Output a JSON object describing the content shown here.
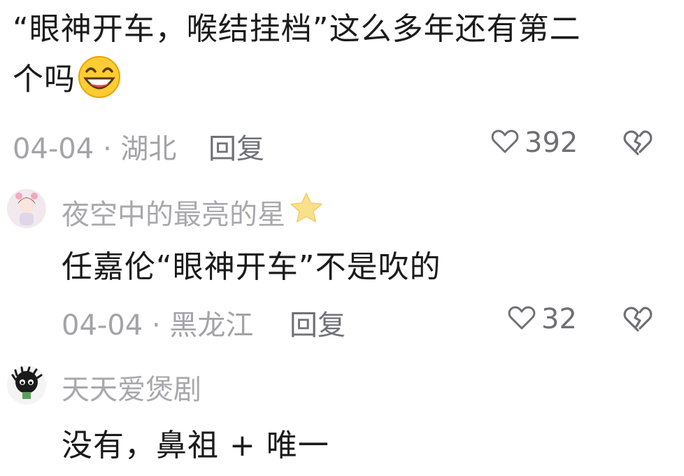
{
  "top_comment": {
    "text_line1": "“眼神开车，喉结挂档”这么多年还有第二",
    "text_line2": "个吗",
    "emoji": "grinning-sweat-emoji",
    "date": "04-04",
    "separator": "·",
    "location": "湖北",
    "reply_label": "回复",
    "like_count": "392"
  },
  "replies": [
    {
      "username": "夜空中的最亮的星",
      "username_emoji": "star-icon",
      "text": "任嘉伦“眼神开车”不是吹的",
      "date": "04-04",
      "separator": "·",
      "location": "黑龙江",
      "reply_label": "回复",
      "like_count": "32"
    },
    {
      "username": "天天爱煲剧",
      "text": "没有，鼻祖 + 唯一"
    }
  ],
  "colors": {
    "text_primary": "#1b1b1b",
    "text_meta": "#a3a3a8",
    "star": "#f7d774"
  }
}
